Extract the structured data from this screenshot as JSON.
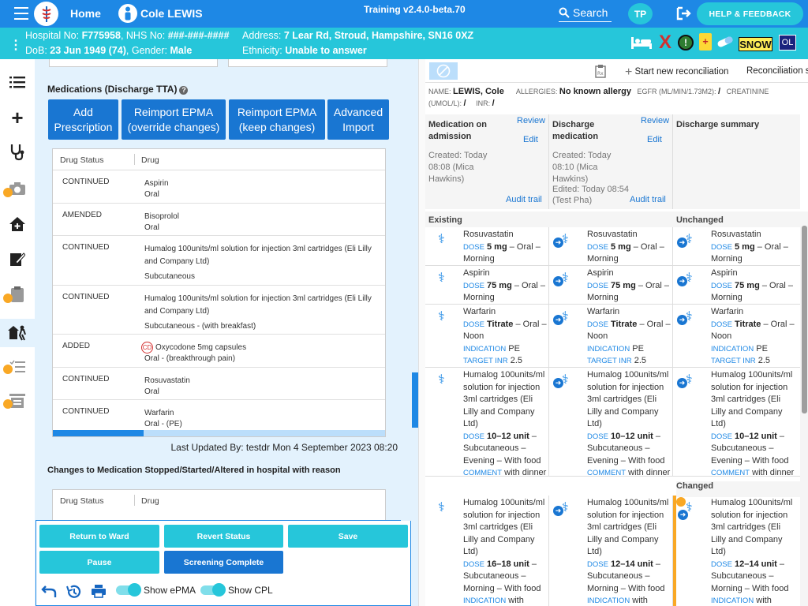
{
  "topbar": {
    "home": "Home",
    "patient_name": "Cole LEWIS",
    "training": "Training v2.4.0-beta.70",
    "search": "Search",
    "user_initials": "TP",
    "help": "HELP & FEEDBACK"
  },
  "banner": {
    "hospital_label": "Hospital No:",
    "hospital_no": "F775958",
    "nhs_label": ", NHS No:",
    "nhs_no": "###-###-####",
    "address_label": "Address:",
    "address": "7 Lear Rd, Stroud, Hampshire, SN16 0XZ",
    "dob_label": "DoB:",
    "dob": "23 Jun 1949 (74)",
    "gender_label": ", Gender:",
    "gender": "Male",
    "ethnicity_label": "Ethnicity:",
    "ethnicity": "Unable to answer",
    "badges": {
      "snow": "SNOW",
      "ol": "OL",
      "x": "X",
      "alert": "!"
    }
  },
  "left": {
    "meds_title": "Medications (Discharge TTA)",
    "buttons": [
      "Add Prescription",
      "Reimport EPMA (override changes)",
      "Reimport EPMA (keep changes)",
      "Advanced Import"
    ],
    "table_headers": [
      "Drug Status",
      "Drug"
    ],
    "rows": [
      {
        "status": "CONTINUED",
        "drug": "Aspirin",
        "route": "Oral"
      },
      {
        "status": "AMENDED",
        "drug": "Bisoprolol",
        "route": "Oral"
      },
      {
        "status": "CONTINUED",
        "drug": "Humalog 100units/ml solution for injection 3ml cartridges (Eli Lilly and Company Ltd)",
        "route": "Subcutaneous"
      },
      {
        "status": "CONTINUED",
        "drug": "Humalog 100units/ml solution for injection 3ml cartridges (Eli Lilly and Company Ltd)",
        "route": "Subcutaneous - (with breakfast)"
      },
      {
        "status": "ADDED",
        "cd": "CD",
        "drug": "Oxycodone 5mg capsules",
        "route": "Oral - (breakthrough pain)"
      },
      {
        "status": "CONTINUED",
        "drug": "Rosuvastatin",
        "route": "Oral"
      },
      {
        "status": "CONTINUED",
        "drug": "Warfarin",
        "route": "Oral - (PE)"
      }
    ],
    "last_updated": "Last Updated By: testdr Mon 4 September 2023 08:20",
    "changes_title": "Changes to Medication Stopped/Started/Altered in hospital with reason",
    "table2_headers": [
      "Drug Status",
      "Drug"
    ]
  },
  "actions": {
    "return_to_ward": "Return to Ward",
    "revert_status": "Revert Status",
    "save": "Save",
    "pause": "Pause",
    "screening_complete": "Screening Complete",
    "show_epma": "Show ePMA",
    "show_cpl": "Show CPL"
  },
  "right": {
    "start_rec": "Start new reconciliation",
    "rec_status": "Reconciliation st",
    "pt": {
      "name_label": "NAME:",
      "name": "LEWIS, Cole",
      "allergies_label": "ALLERGIES:",
      "allergies": "No known allergy",
      "egfr_label": "EGFR (ML/MIN/1.73M2):",
      "egfr": "/",
      "creat_label": "CREATININE",
      "umol_label": "(UMOL/L):",
      "umol": "/",
      "inr_label": "INR:",
      "inr": "/"
    },
    "col1": {
      "title": "Medication on admission",
      "review": "Review",
      "edit": "Edit",
      "created": "Created: Today 08:08 (Mica Hawkins)",
      "audit": "Audit trail"
    },
    "col2": {
      "title": "Discharge medication",
      "review": "Review",
      "edit": "Edit",
      "created": "Created: Today 08:10 (Mica Hawkins)",
      "edited": "Edited: Today 08:54 (Test Pha)",
      "audit": "Audit trail"
    },
    "col3": {
      "title": "Discharge summary"
    },
    "sections": {
      "existing": "Existing",
      "unchanged": "Unchanged",
      "changed": "Changed"
    },
    "keys": {
      "dose": "DOSE",
      "indication": "INDICATION",
      "target_inr": "TARGET INR",
      "comment": "COMMENT"
    },
    "meds": {
      "rosu": {
        "name": "Rosuvastatin",
        "dose": "5 mg",
        "rest": " – Oral – Morning"
      },
      "asp": {
        "name": "Aspirin",
        "dose": "75 mg",
        "rest": " – Oral – Morning"
      },
      "warf": {
        "name": "Warfarin",
        "dose": "Titrate",
        "rest": " – Oral – Noon",
        "indication": "PE",
        "inr": "2.5"
      },
      "hum": {
        "name": "Humalog 100units/ml solution for injection 3ml cartridges (Eli Lilly and Company Ltd)",
        "dose": "10–12 unit",
        "rest": " – Subcutaneous – Evening – With food",
        "comment": "with dinner"
      },
      "hum2a": {
        "name": "Humalog 100units/ml solution for injection 3ml cartridges (Eli Lilly and Company Ltd)",
        "dose": "16–18 unit",
        "rest": " – Subcutaneous – Morning – With food",
        "indication": "with"
      },
      "hum2b": {
        "name": "Humalog 100units/ml solution for injection 3ml cartridges (Eli Lilly and Company Ltd)",
        "dose": "12–14 unit",
        "rest": " – Subcutaneous – Morning – With food",
        "indication": "with"
      }
    }
  }
}
